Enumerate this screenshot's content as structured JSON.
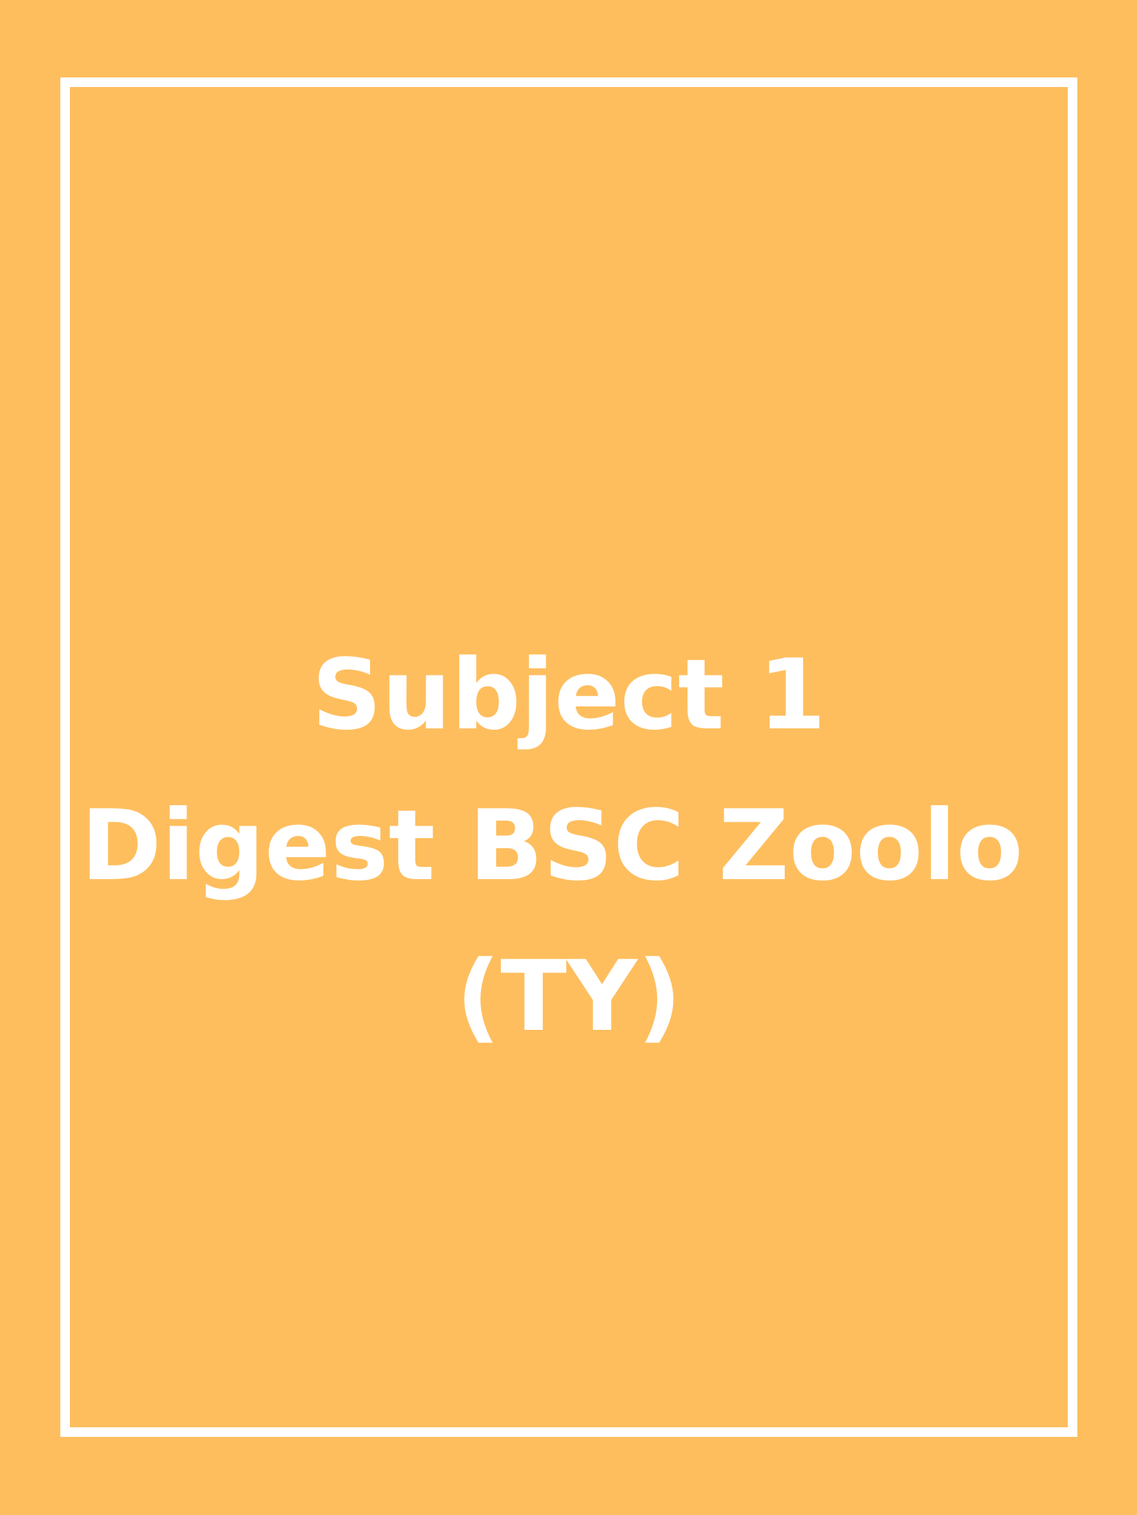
{
  "colors": {
    "background": "#FEBE5E",
    "frame": "#FFFFFF",
    "text": "#FFFFFF"
  },
  "title": {
    "line1": "Subject 1",
    "line2": "Digest BSC Zoolo ",
    "line3": "(TY)"
  }
}
